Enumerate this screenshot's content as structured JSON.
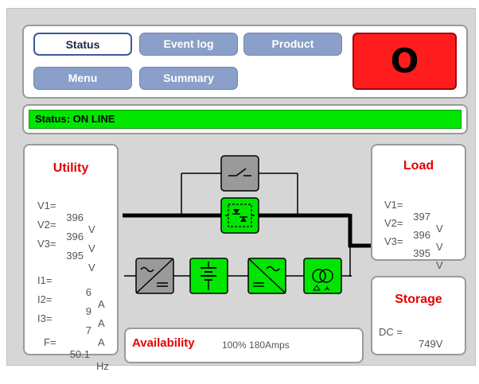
{
  "nav": {
    "buttons": [
      {
        "label": "Status",
        "active": true
      },
      {
        "label": "Event log",
        "active": false
      },
      {
        "label": "Product",
        "active": false
      },
      {
        "label": "Menu",
        "active": false
      },
      {
        "label": "Summary",
        "active": false
      }
    ],
    "power_button_label": "O"
  },
  "status": {
    "text": "Status: ON LINE",
    "color": "#00e600"
  },
  "utility": {
    "title": "Utility",
    "voltages": [
      {
        "label": "V1=",
        "value": "396",
        "unit": "V"
      },
      {
        "label": "V2=",
        "value": "396",
        "unit": "V"
      },
      {
        "label": "V3=",
        "value": "395",
        "unit": "V"
      }
    ],
    "currents": [
      {
        "label": "I1=",
        "value": "6",
        "unit": "A"
      },
      {
        "label": "I2=",
        "value": "9",
        "unit": "A"
      },
      {
        "label": "I3=",
        "value": "7",
        "unit": "A"
      }
    ],
    "frequency": {
      "label": "F=",
      "value": "50.1",
      "unit": "Hz"
    }
  },
  "load": {
    "title": "Load",
    "voltages": [
      {
        "label": "V1=",
        "value": "397",
        "unit": "V"
      },
      {
        "label": "V2=",
        "value": "396",
        "unit": "V"
      },
      {
        "label": "V3=",
        "value": "395",
        "unit": "V"
      }
    ]
  },
  "storage": {
    "title": "Storage",
    "dc": {
      "label": "DC =",
      "value": "749V"
    }
  },
  "availability": {
    "title": "Availability",
    "value": "100%  180Amps"
  },
  "diagram": {
    "icons": [
      {
        "name": "maintenance-bypass-switch-icon",
        "state": "off",
        "color": "#9a9a9a"
      },
      {
        "name": "static-switch-icon",
        "state": "on",
        "color": "#00e600"
      },
      {
        "name": "rectifier-icon",
        "state": "off",
        "color": "#9a9a9a"
      },
      {
        "name": "battery-icon",
        "state": "on",
        "color": "#00e600"
      },
      {
        "name": "inverter-icon",
        "state": "on",
        "color": "#00e600"
      },
      {
        "name": "transformer-icon",
        "state": "on",
        "color": "#00e600"
      }
    ]
  },
  "colors": {
    "accent_red": "#e60000",
    "button_blue": "#8a9fc9",
    "active_green": "#00e600",
    "power_red": "#ff1d1d"
  }
}
